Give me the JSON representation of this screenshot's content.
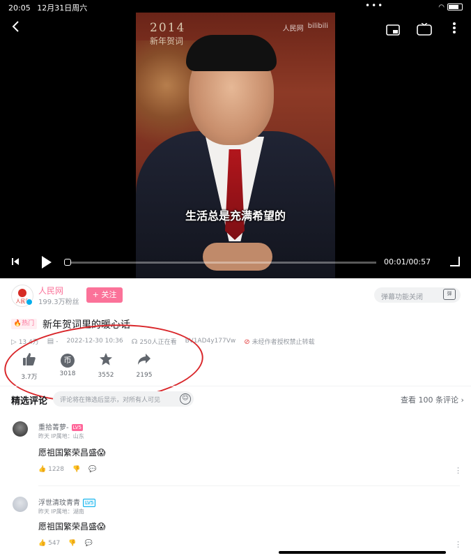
{
  "status_bar": {
    "time": "20:05",
    "date": "12月31日周六",
    "dots": "•••"
  },
  "player": {
    "watermark_year": "2014",
    "watermark_title": "新年贺词",
    "watermark_source": "人民网",
    "watermark_site": "bilibili",
    "subtitle": "生活总是充满希望的",
    "time_display": "00:01/00:57",
    "progress_fraction": 0.02,
    "tv_label": "TV"
  },
  "author": {
    "name": "人民网",
    "fans": "199.3万粉丝",
    "follow_label": "+ 关注",
    "logo_text": "人民网"
  },
  "danmu": {
    "placeholder": "弹幕功能关闭",
    "icon_text": "弹"
  },
  "video": {
    "hot_badge": "热门",
    "title": "新年贺词里的暖心话",
    "views": "13.4万",
    "danmaku_count": "-",
    "date": "2022-12-30  10:36",
    "watching": "250人正在看",
    "bvid": "BV1AD4y177Vw",
    "no_repost": "未经作者授权禁止转载"
  },
  "actions": [
    {
      "icon": "thumb-up-icon",
      "count": "3.7万"
    },
    {
      "icon": "coin-icon",
      "count": "3018"
    },
    {
      "icon": "star-icon",
      "count": "3552"
    },
    {
      "icon": "share-icon",
      "count": "2195"
    }
  ],
  "comments_header": {
    "title": "精选评论",
    "input_placeholder": "评论将在筛选后显示，对所有人可见",
    "view_all": "查看 100 条评论 ›"
  },
  "comments": [
    {
      "user": "重拾菁萝-",
      "level": "LV5",
      "level_color": "#ff6699",
      "meta": "昨天 IP属地：山东",
      "text": "愿祖国繁荣昌盛😱",
      "likes": "1228"
    },
    {
      "user": "浮世清玟青青",
      "level": "LV5",
      "level_color": "#00aeec",
      "meta": "昨天 IP属地：湖南",
      "text": "愿祖国繁荣昌盛😱",
      "likes": "547"
    }
  ],
  "colors": {
    "accent": "#fb7299",
    "annotation": "#d9262a"
  }
}
